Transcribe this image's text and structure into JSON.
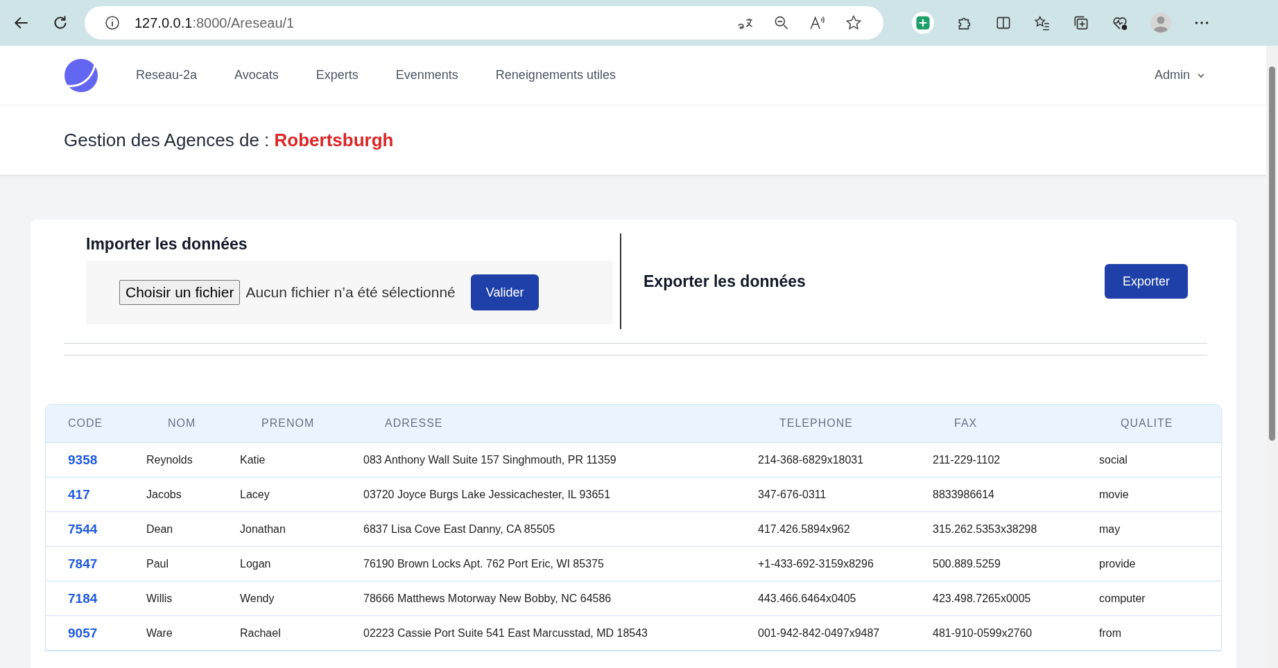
{
  "browser": {
    "url_host": "127.0.0.1",
    "url_path": ":8000/Areseau/1"
  },
  "nav": {
    "links": [
      "Reseau-2a",
      "Avocats",
      "Experts",
      "Evenments",
      "Reneignements utiles"
    ],
    "user": "Admin"
  },
  "header": {
    "title": "Gestion des Agences de :",
    "city": "Robertsburgh"
  },
  "import": {
    "title": "Importer les données",
    "file_button": "Choisir un fichier",
    "file_status": "Aucun fichier n’a été sélectionné",
    "submit": "Valider"
  },
  "export": {
    "title": "Exporter les données",
    "button": "Exporter"
  },
  "table": {
    "columns": [
      "CODE",
      "NOM",
      "PRENOM",
      "ADRESSE",
      "TELEPHONE",
      "FAX",
      "QUALITE"
    ],
    "rows": [
      {
        "code": "9358",
        "nom": "Reynolds",
        "prenom": "Katie",
        "adresse": "083 Anthony Wall Suite 157 Singhmouth, PR 11359",
        "telephone": "214-368-6829x18031",
        "fax": "211-229-1102",
        "qualite": "social"
      },
      {
        "code": "417",
        "nom": "Jacobs",
        "prenom": "Lacey",
        "adresse": "03720 Joyce Burgs Lake Jessicachester, IL 93651",
        "telephone": "347-676-0311",
        "fax": "8833986614",
        "qualite": "movie"
      },
      {
        "code": "7544",
        "nom": "Dean",
        "prenom": "Jonathan",
        "adresse": "6837 Lisa Cove East Danny, CA 85505",
        "telephone": "417.426.5894x962",
        "fax": "315.262.5353x38298",
        "qualite": "may"
      },
      {
        "code": "7847",
        "nom": "Paul",
        "prenom": "Logan",
        "adresse": "76190 Brown Locks Apt. 762 Port Eric, WI 85375",
        "telephone": "+1-433-692-3159x8296",
        "fax": "500.889.5259",
        "qualite": "provide"
      },
      {
        "code": "7184",
        "nom": "Willis",
        "prenom": "Wendy",
        "adresse": "78666 Matthews Motorway New Bobby, NC 64586",
        "telephone": "443.466.6464x0405",
        "fax": "423.498.7265x0005",
        "qualite": "computer"
      },
      {
        "code": "9057",
        "nom": "Ware",
        "prenom": "Rachael",
        "adresse": "02223 Cassie Port Suite 541 East Marcusstad, MD 18543",
        "telephone": "001-942-842-0497x9487",
        "fax": "481-910-0599x2760",
        "qualite": "from"
      }
    ]
  }
}
